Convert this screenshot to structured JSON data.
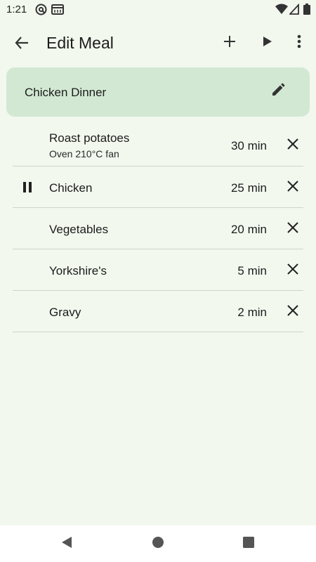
{
  "status_bar": {
    "time": "1:21",
    "icons": [
      "at-sign-notification-icon",
      "window-notification-icon",
      "wifi-icon",
      "cell-signal-icon",
      "battery-icon"
    ]
  },
  "app_bar": {
    "title": "Edit Meal",
    "icons": [
      "back-arrow-icon",
      "add-icon",
      "play-icon",
      "more-vert-icon"
    ]
  },
  "meal": {
    "name": "Chicken Dinner",
    "edit_icon": "pencil-icon"
  },
  "steps": [
    {
      "name": "Roast potatoes",
      "subtitle": "Oven 210°C fan",
      "duration": "30 min",
      "paused": false
    },
    {
      "name": "Chicken",
      "subtitle": "",
      "duration": "25 min",
      "paused": true
    },
    {
      "name": "Vegetables",
      "subtitle": "",
      "duration": "20 min",
      "paused": false
    },
    {
      "name": "Yorkshire's",
      "subtitle": "",
      "duration": "5 min",
      "paused": false
    },
    {
      "name": "Gravy",
      "subtitle": "",
      "duration": "2 min",
      "paused": false
    }
  ],
  "nav_bar": {
    "icons": [
      "nav-back-icon",
      "nav-home-icon",
      "nav-recents-icon"
    ]
  },
  "colors": {
    "background": "#f2f8ee",
    "meal_card": "#d2e8d3",
    "text": "#1c1c1c",
    "divider": "#cfd4cc"
  }
}
